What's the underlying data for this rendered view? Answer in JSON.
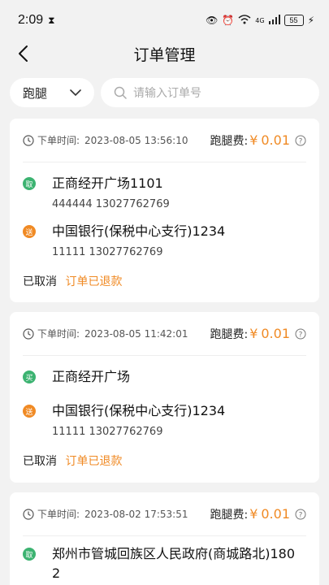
{
  "status_bar": {
    "time": "2:09",
    "network": "4G",
    "battery": "55"
  },
  "nav": {
    "title": "订单管理"
  },
  "filter": {
    "select_value": "跑腿",
    "search_placeholder": "请输入订单号"
  },
  "labels": {
    "order_time": "下单时间:",
    "fee": "跑腿费:",
    "currency": "¥"
  },
  "orders": [
    {
      "time": "2023-08-05 13:56:10",
      "fee": "0.01",
      "from_tag": "取",
      "from_address": "正商经开广场1101",
      "from_contact": "444444 13027762769",
      "to_tag": "送",
      "to_address": "中国银行(保税中心支行)1234",
      "to_contact": "11111 13027762769",
      "status": "已取消",
      "refund": "订单已退款"
    },
    {
      "time": "2023-08-05 11:42:01",
      "fee": "0.01",
      "from_tag": "买",
      "from_address": "正商经开广场",
      "to_tag": "送",
      "to_address": "中国银行(保税中心支行)1234",
      "to_contact": "11111 13027762769",
      "status": "已取消",
      "refund": "订单已退款"
    },
    {
      "time": "2023-08-02 17:53:51",
      "fee": "0.01",
      "from_tag": "取",
      "from_address": "郑州市管城回族区人民政府(商城路北)1802"
    }
  ],
  "colors": {
    "accent": "#f08a24",
    "green": "#3cb371",
    "background": "#f2f2f2"
  }
}
